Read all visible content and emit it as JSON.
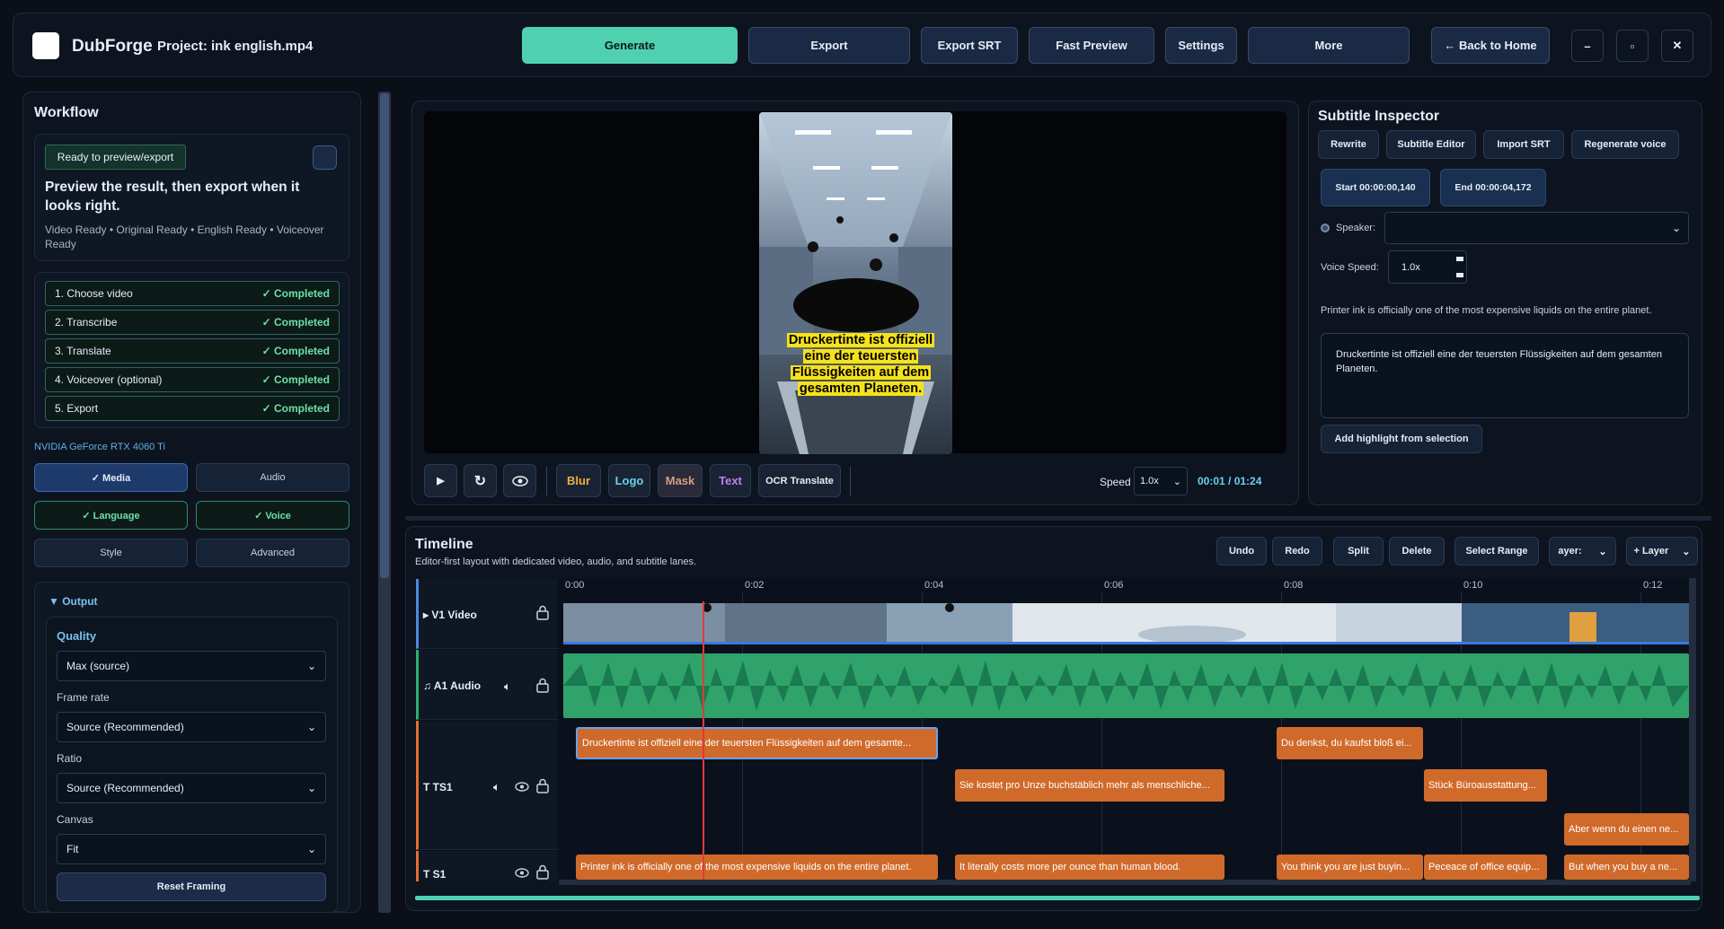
{
  "app": {
    "name": "DubForge",
    "project": "Project: ink english.mp4"
  },
  "toolbar": {
    "generate": "Generate",
    "export": "Export",
    "export_srt": "Export SRT",
    "fast_preview": "Fast Preview",
    "settings": "Settings",
    "more": "More",
    "back_home": "← Back to Home",
    "minimize": "–",
    "maximize": "▫",
    "close": "✕"
  },
  "colors": {
    "accent": "#4fd1b0",
    "clip": "#d06a2a",
    "audio": "#1e8a5c",
    "playhead": "#e03a3a"
  },
  "workflow": {
    "title": "Workflow",
    "status_badge": "Ready to preview/export",
    "headline": "Preview the result, then export when it looks right.",
    "readiness": "Video Ready • Original Ready • English Ready • Voiceover Ready",
    "steps": [
      {
        "label": "1.  Choose video",
        "status": "✓ Completed"
      },
      {
        "label": "2.  Transcribe",
        "status": "✓ Completed"
      },
      {
        "label": "3.  Translate",
        "status": "✓ Completed"
      },
      {
        "label": "4.  Voiceover (optional)",
        "status": "✓ Completed"
      },
      {
        "label": "5.  Export",
        "status": "✓ Completed"
      }
    ],
    "gpu": "NVIDIA GeForce RTX 4060 Ti",
    "tabs": {
      "media": "✓ Media",
      "audio": "Audio",
      "language": "✓ Language",
      "voice": "✓ Voice",
      "style": "Style",
      "advanced": "Advanced"
    }
  },
  "output": {
    "title": "▼ Output",
    "quality_title": "Quality",
    "quality": "Max (source)",
    "frame_rate_label": "Frame rate",
    "frame_rate": "Source (Recommended)",
    "ratio_label": "Ratio",
    "ratio": "Source (Recommended)",
    "canvas_label": "Canvas",
    "canvas": "Fit",
    "reset_framing": "Reset Framing"
  },
  "preview": {
    "subtitle_overlay": "Druckertinte ist offiziell eine der teuersten Flüssigkeiten auf dem gesamten Planeten.",
    "tools": {
      "blur": "Blur",
      "logo": "Logo",
      "mask": "Mask",
      "text": "Text",
      "ocr": "OCR Translate"
    },
    "speed_label": "Speed",
    "speed_value": "1.0x",
    "time": "00:01 / 01:24"
  },
  "inspector": {
    "title": "Subtitle Inspector",
    "rewrite": "Rewrite",
    "subtitle_editor": "Subtitle Editor",
    "import_srt": "Import SRT",
    "regenerate_voice": "Regenerate voice",
    "start": "Start  00:00:00,140",
    "end": "End  00:00:04,172",
    "speaker_label": "Speaker:",
    "voice_speed_label": "Voice Speed:",
    "voice_speed": "1.0x",
    "original_text": "Printer ink is officially one of the most expensive liquids on the entire planet.",
    "translated_text": "Druckertinte ist offiziell eine der teuersten Flüssigkeiten auf dem gesamten Planeten.",
    "add_highlight": "Add highlight from selection"
  },
  "timeline": {
    "title": "Timeline",
    "subtitle": "Editor-first layout with dedicated video, audio, and subtitle lanes.",
    "undo": "Undo",
    "redo": "Redo",
    "split": "Split",
    "delete": "Delete",
    "select_range": "Select Range",
    "layer_select": "ayer:",
    "add_layer": "+ Layer",
    "ticks": [
      "0:00",
      "0:02",
      "0:04",
      "0:06",
      "0:08",
      "0:10",
      "0:12"
    ],
    "tracks": {
      "v1": "▸ V1 Video",
      "a1": "♫ A1 Audio",
      "ts1": "T TS1",
      "s1": "T S1"
    },
    "ts1_clips": [
      "Druckertinte ist offiziell eine der teuersten Flüssigkeiten auf dem gesamte...",
      "Sie kostet pro Unze buchstäblich mehr als menschliche...",
      "Du denkst, du kaufst bloß ei...",
      "Stück Büroausstattung...",
      "Aber wenn du einen ne..."
    ],
    "s1_clips": [
      "Printer ink is officially one of the most expensive liquids on the entire planet.",
      "It literally costs more per ounce than human blood.",
      "You think you are just buyin...",
      "Pecеace of office equip...",
      "But when you buy a ne..."
    ]
  }
}
